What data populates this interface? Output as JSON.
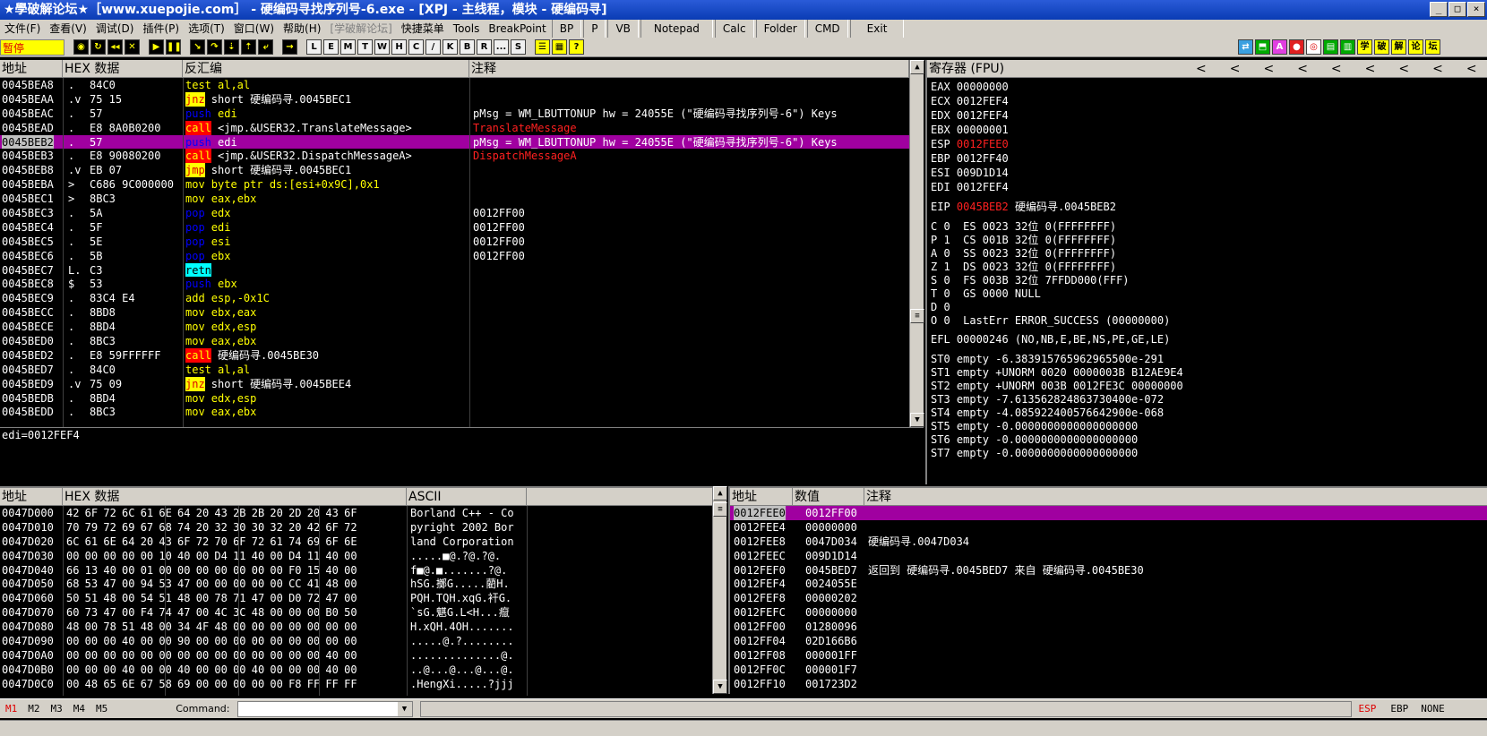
{
  "title": "★學破解论坛★［www.xuepojie.com］ - 硬编码寻找序列号-6.exe - [XPJ - 主线程，模块 - 硬编码寻]",
  "window_buttons": [
    "_",
    "□",
    "×"
  ],
  "menu": [
    "文件(F)",
    "查看(V)",
    "调试(D)",
    "插件(P)",
    "选项(T)",
    "窗口(W)",
    "帮助(H)",
    "[学破解论坛]",
    "快捷菜单",
    "Tools",
    "BreakPoint"
  ],
  "menu_tools": [
    "BP",
    "P",
    "VB",
    "Notepad",
    "Calc",
    "Folder",
    "CMD",
    "Exit"
  ],
  "status_label": "暂停",
  "toolbar_letters": [
    "L",
    "E",
    "M",
    "T",
    "W",
    "H",
    "C",
    "/",
    "K",
    "B",
    "R",
    "...",
    "S"
  ],
  "toolbar_right": [
    "学",
    "破",
    "解",
    "论",
    "坛"
  ],
  "cpu": {
    "headers": {
      "addr": "地址",
      "hex": "HEX 数据",
      "disasm": "反汇编",
      "comment": "注释"
    },
    "rows": [
      {
        "addr": "0045BEA8",
        "mark": ".",
        "hex": "84C0",
        "m": "test",
        "ops": "al,al",
        "cm": ""
      },
      {
        "addr": "0045BEAA",
        "mark": ".v",
        "hex": "75 15",
        "m": "jnz",
        "ops": "short 硬编码寻.0045BEC1",
        "cm": ""
      },
      {
        "addr": "0045BEAC",
        "mark": ".",
        "hex": "57",
        "m": "push",
        "ops": "edi",
        "cm": "pMsg = WM_LBUTTONUP hw = 24055E (\"硬编码寻找序列号-6\") Keys"
      },
      {
        "addr": "0045BEAD",
        "mark": ".",
        "hex": "E8 8A0B0200",
        "m": "call",
        "ops": "<jmp.&USER32.TranslateMessage>",
        "cm": "TranslateMessage"
      },
      {
        "addr": "0045BEB2",
        "mark": ".",
        "hex": "57",
        "m": "push",
        "ops": "edi",
        "cm": "pMsg = WM_LBUTTONUP hw = 24055E (\"硬编码寻找序列号-6\") Keys"
      },
      {
        "addr": "0045BEB3",
        "mark": ".",
        "hex": "E8 90080200",
        "m": "call",
        "ops": "<jmp.&USER32.DispatchMessageA>",
        "cm": "DispatchMessageA"
      },
      {
        "addr": "0045BEB8",
        "mark": ".v",
        "hex": "EB 07",
        "m": "jmp",
        "ops": "short 硬编码寻.0045BEC1",
        "cm": ""
      },
      {
        "addr": "0045BEBA",
        "mark": ">",
        "hex": "C686 9C000000",
        "m": "mov",
        "ops": "byte ptr ds:[esi+0x9C],0x1",
        "cm": ""
      },
      {
        "addr": "0045BEC1",
        "mark": ">",
        "hex": "8BC3",
        "m": "mov",
        "ops": "eax,ebx",
        "cm": ""
      },
      {
        "addr": "0045BEC3",
        "mark": ".",
        "hex": "5A",
        "m": "pop",
        "ops": "edx",
        "cm": "0012FF00"
      },
      {
        "addr": "0045BEC4",
        "mark": ".",
        "hex": "5F",
        "m": "pop",
        "ops": "edi",
        "cm": "0012FF00"
      },
      {
        "addr": "0045BEC5",
        "mark": ".",
        "hex": "5E",
        "m": "pop",
        "ops": "esi",
        "cm": "0012FF00"
      },
      {
        "addr": "0045BEC6",
        "mark": ".",
        "hex": "5B",
        "m": "pop",
        "ops": "ebx",
        "cm": "0012FF00"
      },
      {
        "addr": "0045BEC7",
        "mark": "L.",
        "hex": "C3",
        "m": "retn",
        "ops": "",
        "cm": ""
      },
      {
        "addr": "0045BEC8",
        "mark": "$",
        "hex": "53",
        "m": "push",
        "ops": "ebx",
        "cm": ""
      },
      {
        "addr": "0045BEC9",
        "mark": ".",
        "hex": "83C4 E4",
        "m": "add",
        "ops": "esp,-0x1C",
        "cm": ""
      },
      {
        "addr": "0045BECC",
        "mark": ".",
        "hex": "8BD8",
        "m": "mov",
        "ops": "ebx,eax",
        "cm": ""
      },
      {
        "addr": "0045BECE",
        "mark": ".",
        "hex": "8BD4",
        "m": "mov",
        "ops": "edx,esp",
        "cm": ""
      },
      {
        "addr": "0045BED0",
        "mark": ".",
        "hex": "8BC3",
        "m": "mov",
        "ops": "eax,ebx",
        "cm": ""
      },
      {
        "addr": "0045BED2",
        "mark": ".",
        "hex": "E8 59FFFFFF",
        "m": "call",
        "ops": "硬编码寻.0045BE30",
        "cm": ""
      },
      {
        "addr": "0045BED7",
        "mark": ".",
        "hex": "84C0",
        "m": "test",
        "ops": "al,al",
        "cm": ""
      },
      {
        "addr": "0045BED9",
        "mark": ".v",
        "hex": "75 09",
        "m": "jnz",
        "ops": "short 硬编码寻.0045BEE4",
        "cm": ""
      },
      {
        "addr": "0045BEDB",
        "mark": ".",
        "hex": "8BD4",
        "m": "mov",
        "ops": "edx,esp",
        "cm": ""
      },
      {
        "addr": "0045BEDD",
        "mark": ".",
        "hex": "8BC3",
        "m": "mov",
        "ops": "eax,ebx",
        "cm": ""
      }
    ],
    "info": "edi=0012FEF4"
  },
  "registers": {
    "header": "寄存器 (FPU)",
    "gpr": [
      [
        "EAX",
        "00000000"
      ],
      [
        "ECX",
        "0012FEF4"
      ],
      [
        "EDX",
        "0012FEF4"
      ],
      [
        "EBX",
        "00000001"
      ],
      [
        "ESP",
        "0012FEE0"
      ],
      [
        "EBP",
        "0012FF40"
      ],
      [
        "ESI",
        "009D1D14"
      ],
      [
        "EDI",
        "0012FEF4"
      ]
    ],
    "eip": {
      "name": "EIP",
      "val": "0045BEB2",
      "sym": "硬编码寻.0045BEB2"
    },
    "flags": [
      "C 0  ES 0023 32位 0(FFFFFFFF)",
      "P 1  CS 001B 32位 0(FFFFFFFF)",
      "A 0  SS 0023 32位 0(FFFFFFFF)",
      "Z 1  DS 0023 32位 0(FFFFFFFF)",
      "S 0  FS 003B 32位 7FFDD000(FFF)",
      "T 0  GS 0000 NULL",
      "D 0",
      "O 0  LastErr ERROR_SUCCESS (00000000)"
    ],
    "efl": "EFL 00000246 (NO,NB,E,BE,NS,PE,GE,LE)",
    "fpu": [
      "ST0 empty -6.383915765962965500e-291",
      "ST1 empty +UNORM 0020 0000003B B12AE9E4",
      "ST2 empty +UNORM 003B 0012FE3C 00000000",
      "ST3 empty -7.613562824863730400e-072",
      "ST4 empty -4.085922400576642900e-068",
      "ST5 empty -0.0000000000000000000",
      "ST6 empty -0.0000000000000000000",
      "ST7 empty -0.0000000000000000000"
    ]
  },
  "dump": {
    "headers": {
      "addr": "地址",
      "hex": "HEX 数据",
      "ascii": "ASCII"
    },
    "rows": [
      {
        "addr": "0047D000",
        "hex": "42 6F 72 6C 61 6E 64 20 43 2B 2B 20 2D 20 43 6F",
        "asc": "Borland C++ - Co"
      },
      {
        "addr": "0047D010",
        "hex": "70 79 72 69 67 68 74 20 32 30 30 32 20 42 6F 72",
        "asc": "pyright 2002 Bor"
      },
      {
        "addr": "0047D020",
        "hex": "6C 61 6E 64 20 43 6F 72 70 6F 72 61 74 69 6F 6E",
        "asc": "land Corporation"
      },
      {
        "addr": "0047D030",
        "hex": "00 00 00 00 00 10 40 00 D4 11 40 00 D4 11 40 00",
        "asc": ".....■@.?@.?@."
      },
      {
        "addr": "0047D040",
        "hex": "66 13 40 00 01 00 00 00 00 00 00 00 F0 15 40 00",
        "asc": "f■@.■.......?@."
      },
      {
        "addr": "0047D050",
        "hex": "68 53 47 00 94 53 47 00 00 00 00 00 CC 41 48 00",
        "asc": "hSG.擲G.....藺H."
      },
      {
        "addr": "0047D060",
        "hex": "50 51 48 00 54 51 48 00 78 71 47 00 D0 72 47 00",
        "asc": "PQH.TQH.xqG.衦G."
      },
      {
        "addr": "0047D070",
        "hex": "60 73 47 00 F4 74 47 00 4C 3C 48 00 00 00 B0 50",
        "asc": "`sG.魌G.L<H...癙"
      },
      {
        "addr": "0047D080",
        "hex": "48 00 78 51 48 00 34 4F 48 00 00 00 00 00 00 00",
        "asc": "H.xQH.4OH......."
      },
      {
        "addr": "0047D090",
        "hex": "00 00 00 40 00 00 90 00 00 00 00 00 00 00 00 00",
        "asc": ".....@.?........"
      },
      {
        "addr": "0047D0A0",
        "hex": "00 00 00 00 00 00 00 00 00 00 00 00 00 00 40 00",
        "asc": "..............@."
      },
      {
        "addr": "0047D0B0",
        "hex": "00 00 00 40 00 00 40 00 00 00 40 00 00 00 40 00",
        "asc": "..@...@...@...@."
      },
      {
        "addr": "0047D0C0",
        "hex": "00 48 65 6E 67 58 69 00 00 00 00 00 F8 FF FF FF",
        "asc": ".HengXi.....?jjj"
      }
    ]
  },
  "stack": {
    "headers": {
      "addr": "地址",
      "val": "数值",
      "cm": "注释"
    },
    "rows": [
      {
        "addr": "0012FEE0",
        "val": "0012FF00",
        "cm": ""
      },
      {
        "addr": "0012FEE4",
        "val": "00000000",
        "cm": ""
      },
      {
        "addr": "0012FEE8",
        "val": "0047D034",
        "cm": "硬编码寻.0047D034"
      },
      {
        "addr": "0012FEEC",
        "val": "009D1D14",
        "cm": ""
      },
      {
        "addr": "0012FEF0",
        "val": "0045BED7",
        "cm": "返回到 硬编码寻.0045BED7 来自 硬编码寻.0045BE30"
      },
      {
        "addr": "0012FEF4",
        "val": "0024055E",
        "cm": ""
      },
      {
        "addr": "0012FEF8",
        "val": "00000202",
        "cm": ""
      },
      {
        "addr": "0012FEFC",
        "val": "00000000",
        "cm": ""
      },
      {
        "addr": "0012FF00",
        "val": "01280096",
        "cm": ""
      },
      {
        "addr": "0012FF04",
        "val": "02D166B6",
        "cm": ""
      },
      {
        "addr": "0012FF08",
        "val": "000001FF",
        "cm": ""
      },
      {
        "addr": "0012FF0C",
        "val": "000001F7",
        "cm": ""
      },
      {
        "addr": "0012FF10",
        "val": "001723D2",
        "cm": ""
      }
    ]
  },
  "statusbar": {
    "tabs": [
      "M1",
      "M2",
      "M3",
      "M4",
      "M5"
    ],
    "command_label": "Command:",
    "command_value": "",
    "right": [
      "ESP",
      "EBP",
      "NONE"
    ]
  },
  "colors": {
    "highlight": "#a000a0",
    "bg": "#000000",
    "panel": "#d4d0c8"
  }
}
